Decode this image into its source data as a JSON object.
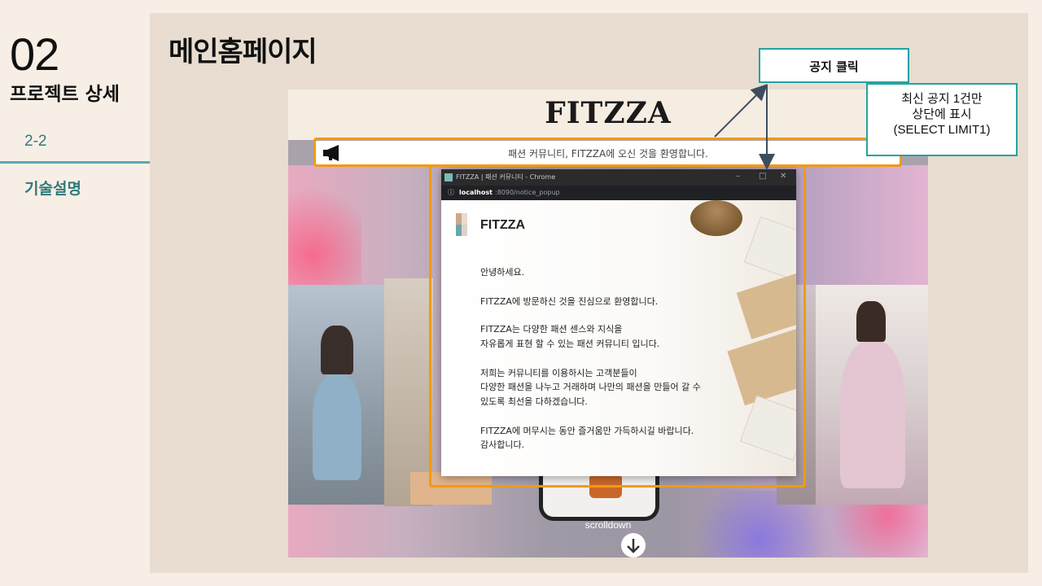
{
  "section": {
    "number": "02",
    "title": "프로젝트 상세"
  },
  "subsection": {
    "number": "2-2",
    "title": "기술설명"
  },
  "page_title": "메인홈페이지",
  "website": {
    "brand": "FITZZA",
    "notice_text": "패션 커뮤니티, FITZZA에 오신 것을 환영합니다.",
    "scroll_label": "scrolldown"
  },
  "popup": {
    "window_title": "FITZZA | 패션 커뮤니티 - Chrome",
    "url_host": "localhost",
    "url_path": ":8090/notice_popup",
    "brand": "FITZZA",
    "logo_colors": [
      "#c9a98a",
      "#e8dccd",
      "#6aa6ac",
      "#ddd3c6"
    ],
    "lines": [
      "안녕하세요.",
      "FITZZA에 방문하신 것을 진심으로 환영합니다.",
      "FITZZA는 다양한 패션 센스와 지식을",
      "자유롭게 표현 할 수 있는 패션 커뮤니티 입니다.",
      "저희는 커뮤니티를 이용하시는 고객분들이",
      "다양한 패션을 나누고 거래하며 나만의 패션을 만들어 갈 수",
      "있도록 최선을 다하겠습니다.",
      "FITZZA에 머무시는 동안 즐거움만 가득하시길 바랍니다.",
      "감사합니다."
    ]
  },
  "callouts": {
    "click": "공지 클릭",
    "latest_line1": "최신 공지 1건만",
    "latest_line2": "상단에 표시",
    "latest_line3": "(SELECT LIMIT1)"
  },
  "colors": {
    "accent_teal": "#23a3a1",
    "highlight_orange": "#f29a10",
    "subsection_text": "#2f7a7c"
  }
}
